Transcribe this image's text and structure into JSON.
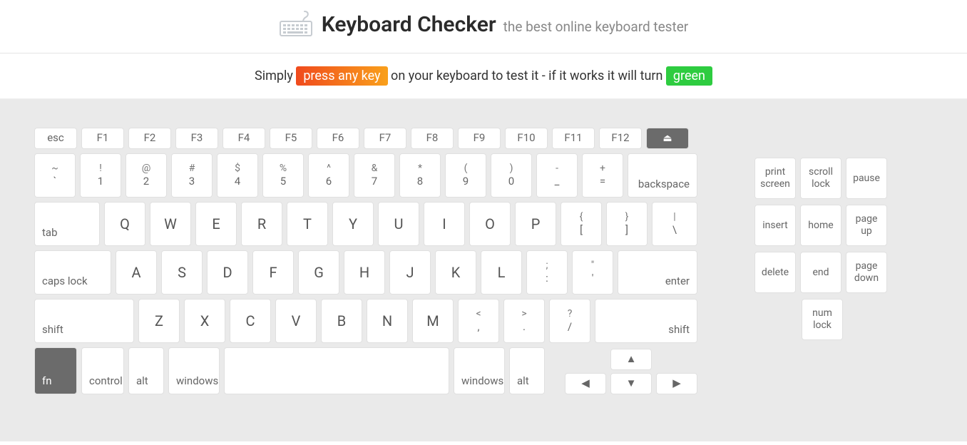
{
  "header": {
    "title": "Keyboard Checker",
    "subtitle": "the best online keyboard tester"
  },
  "instruction": {
    "pre": "Simply ",
    "badge1": "press any key",
    "mid": " on your keyboard to test it - if it works it will turn ",
    "badge2": "green"
  },
  "rows": {
    "fn": [
      "esc",
      "F1",
      "F2",
      "F3",
      "F4",
      "F5",
      "F6",
      "F7",
      "F8",
      "F9",
      "F10",
      "F11",
      "F12"
    ],
    "num_top": [
      "~",
      "!",
      "@",
      "#",
      "$",
      "%",
      "^",
      "&",
      "*",
      "(",
      ")",
      "-",
      "+"
    ],
    "num_bot": [
      "`",
      "1",
      "2",
      "3",
      "4",
      "5",
      "6",
      "7",
      "8",
      "9",
      "0",
      "_",
      "="
    ],
    "backspace": "backspace",
    "tab": "tab",
    "qwerty": [
      "Q",
      "W",
      "E",
      "R",
      "T",
      "Y",
      "U",
      "I",
      "O",
      "P"
    ],
    "brackets_top": [
      "{",
      "}",
      "|"
    ],
    "brackets_bot": [
      "[",
      "]",
      "\\"
    ],
    "caps": "caps lock",
    "asdf": [
      "A",
      "S",
      "D",
      "F",
      "G",
      "H",
      "J",
      "K",
      "L"
    ],
    "semi_top": [
      ";",
      "\""
    ],
    "semi_bot": [
      ":",
      "'"
    ],
    "enter": "enter",
    "lshift": "shift",
    "zxcv": [
      "Z",
      "X",
      "C",
      "V",
      "B",
      "N",
      "M"
    ],
    "punct_top": [
      "<",
      ">",
      "?"
    ],
    "punct_bot": [
      ",",
      ".",
      "/"
    ],
    "rshift": "shift",
    "bottom": {
      "fn": "fn",
      "control": "control",
      "alt": "alt",
      "windows": "windows",
      "windows2": "windows",
      "alt2": "alt"
    },
    "arrows": {
      "up": "▲",
      "down": "▼",
      "left": "◀",
      "right": "▶"
    }
  },
  "side": {
    "r1": [
      "print screen",
      "scroll lock",
      "pause"
    ],
    "r2": [
      "insert",
      "home",
      "page up"
    ],
    "r3": [
      "delete",
      "end",
      "page down"
    ],
    "r4": [
      "num lock"
    ]
  },
  "eject": "⏏"
}
